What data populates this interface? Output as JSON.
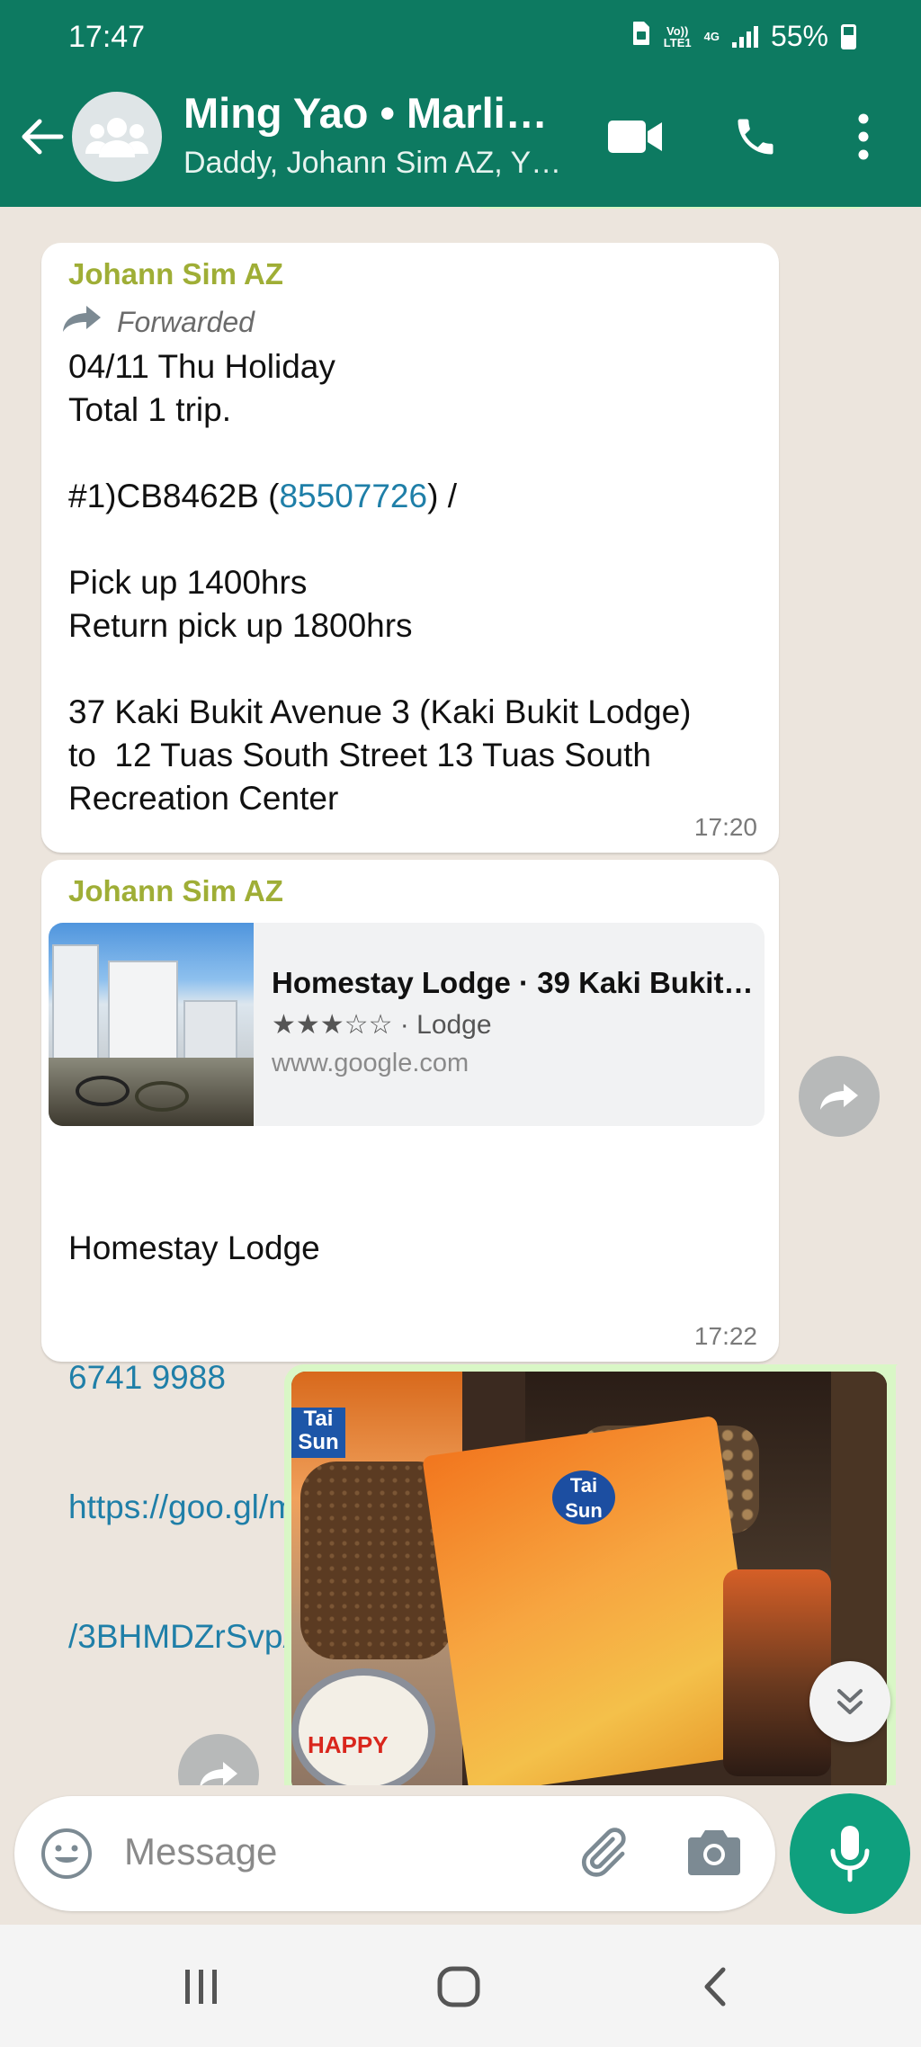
{
  "status": {
    "time": "17:47",
    "network_top": "Vo))",
    "network_bottom": "LTE1",
    "gen": "4G",
    "battery": "55%"
  },
  "header": {
    "title": "Ming Yao • Marli…",
    "subtitle": "Daddy, Johann Sim AZ, Y…"
  },
  "messages": [
    {
      "sender": "Johann Sim AZ",
      "forwarded": "Forwarded",
      "lines_before_phone": "04/11 Thu Holiday\nTotal 1 trip.\n\n#1)CB8462B (",
      "phone": "85507726",
      "lines_after_phone": ") /\n\nPick up 1400hrs\nReturn pick up 1800hrs\n\n37 Kaki Bukit Avenue 3 (Kaki Bukit Lodge)\nto  12 Tuas South Street 13 Tuas South\nRecreation Center",
      "time": "17:20"
    },
    {
      "sender": "Johann Sim AZ",
      "preview_title": "Homestay Lodge · 39 Kaki Bukit…",
      "preview_stars": "★★★☆☆ · Lodge",
      "preview_url": "www.google.com",
      "text": "Homestay Lodge",
      "phone": "6741 9988",
      "link1": "https://goo.gl/maps",
      "link2": "/3BHMDZrSvpAJxeUs6",
      "time": "17:22"
    }
  ],
  "photo_labels": {
    "brand_a": "Tai Sun",
    "brand_b": "Tai Sun",
    "tin": "HAPPY"
  },
  "input": {
    "placeholder": "Message"
  },
  "colors": {
    "header": "#0d7a61",
    "sender": "#9fae36",
    "link": "#1f7fa8",
    "mic": "#0fa07e",
    "outgoing": "#d9f7c6"
  }
}
